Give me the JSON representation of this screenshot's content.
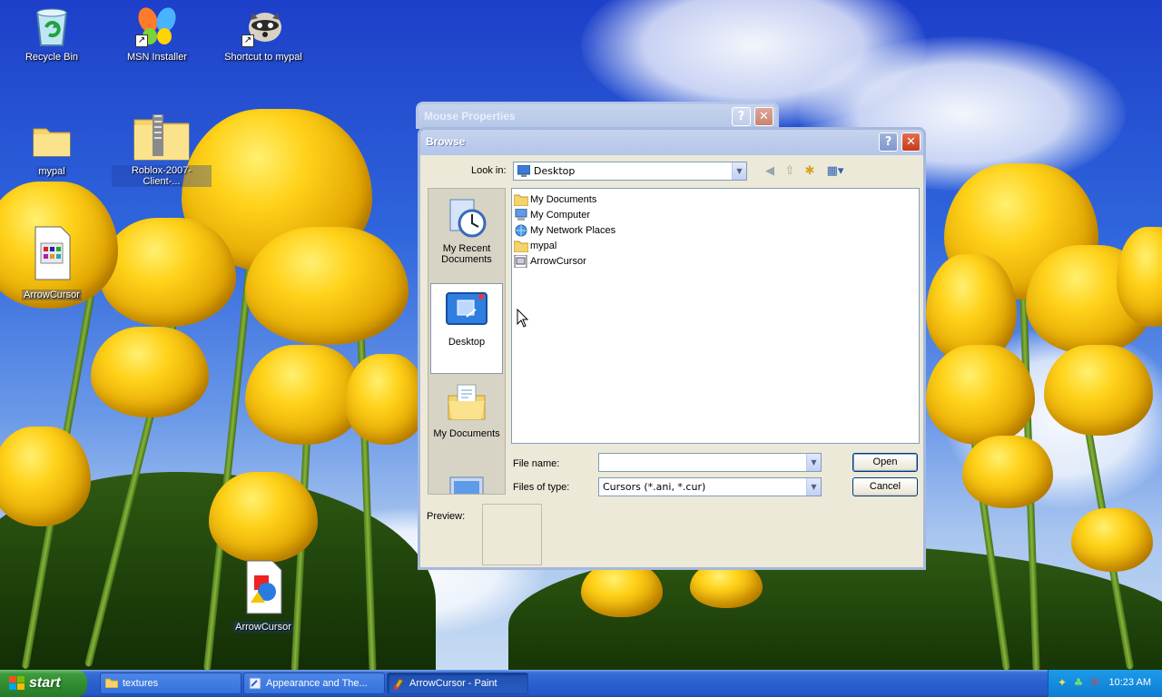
{
  "desktop": {
    "icons": [
      {
        "label": "Recycle Bin",
        "icon": "recycle-bin-icon"
      },
      {
        "label": "MSN Installer",
        "icon": "msn-butterfly-icon"
      },
      {
        "label": "Shortcut to mypal",
        "icon": "raccoon-icon"
      },
      {
        "label": "mypal",
        "icon": "folder-icon"
      },
      {
        "label": "Roblox-2007-Client-...",
        "icon": "zip-folder-icon"
      },
      {
        "label": "ArrowCursor",
        "icon": "cursor-file-icon"
      },
      {
        "label": "ArrowCursor",
        "icon": "paint-file-icon"
      }
    ]
  },
  "mouse_properties": {
    "title": "Mouse Properties"
  },
  "browse": {
    "title": "Browse",
    "help_symbol": "?",
    "close_symbol": "✕",
    "look_in_label": "Look in:",
    "look_in_value": "Desktop",
    "places": [
      {
        "label": "My Recent Documents",
        "icon": "recent-documents-icon"
      },
      {
        "label": "Desktop",
        "icon": "desktop-icon"
      },
      {
        "label": "My Documents",
        "icon": "my-documents-icon"
      }
    ],
    "files": [
      {
        "name": "My Documents",
        "icon": "folder-icon"
      },
      {
        "name": "My Computer",
        "icon": "computer-icon"
      },
      {
        "name": "My Network Places",
        "icon": "network-icon"
      },
      {
        "name": "mypal",
        "icon": "folder-icon"
      },
      {
        "name": "ArrowCursor",
        "icon": "cursor-file-icon"
      }
    ],
    "file_name_label": "File name:",
    "file_name_value": "",
    "files_of_type_label": "Files of type:",
    "files_of_type_value": "Cursors (*.ani, *.cur)",
    "open_label": "Open",
    "cancel_label": "Cancel",
    "preview_label": "Preview:"
  },
  "taskbar": {
    "start_label": "start",
    "tasks": [
      {
        "label": "textures",
        "icon": "folder-icon"
      },
      {
        "label": "Appearance and The...",
        "icon": "control-panel-icon"
      },
      {
        "label": "ArrowCursor - Paint",
        "icon": "paint-icon"
      }
    ],
    "clock": "10:23 AM"
  },
  "colors": {
    "xp_blue": "#2a5fcf",
    "start_green": "#2f8a2f",
    "dialog_bg": "#ece9d8"
  }
}
